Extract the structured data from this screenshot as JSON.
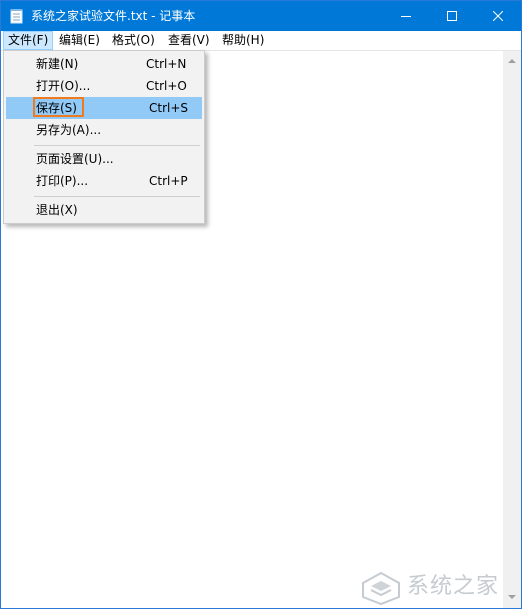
{
  "window": {
    "title": "系统之家试验文件.txt - 记事本"
  },
  "menubar": {
    "items": [
      {
        "label": "文件(F)"
      },
      {
        "label": "编辑(E)"
      },
      {
        "label": "格式(O)"
      },
      {
        "label": "查看(V)"
      },
      {
        "label": "帮助(H)"
      }
    ]
  },
  "file_menu": {
    "items": [
      {
        "label": "新建(N)",
        "shortcut": "Ctrl+N"
      },
      {
        "label": "打开(O)...",
        "shortcut": "Ctrl+O"
      },
      {
        "label": "保存(S)",
        "shortcut": "Ctrl+S"
      },
      {
        "label": "另存为(A)...",
        "shortcut": ""
      },
      {
        "label": "页面设置(U)...",
        "shortcut": ""
      },
      {
        "label": "打印(P)...",
        "shortcut": "Ctrl+P"
      },
      {
        "label": "退出(X)",
        "shortcut": ""
      }
    ],
    "highlighted_index": 2
  },
  "colors": {
    "titlebar": "#0078d7",
    "menu_active": "#cce8ff",
    "item_highlight": "#91c9f7",
    "annotation_box": "#f07b1f"
  },
  "icons": {
    "app": "notepad-icon",
    "minimize": "minimize-icon",
    "maximize": "maximize-icon",
    "close": "close-icon",
    "logo": "xitongzhijia-logo-icon"
  },
  "watermark": {
    "text": "系统之家"
  }
}
